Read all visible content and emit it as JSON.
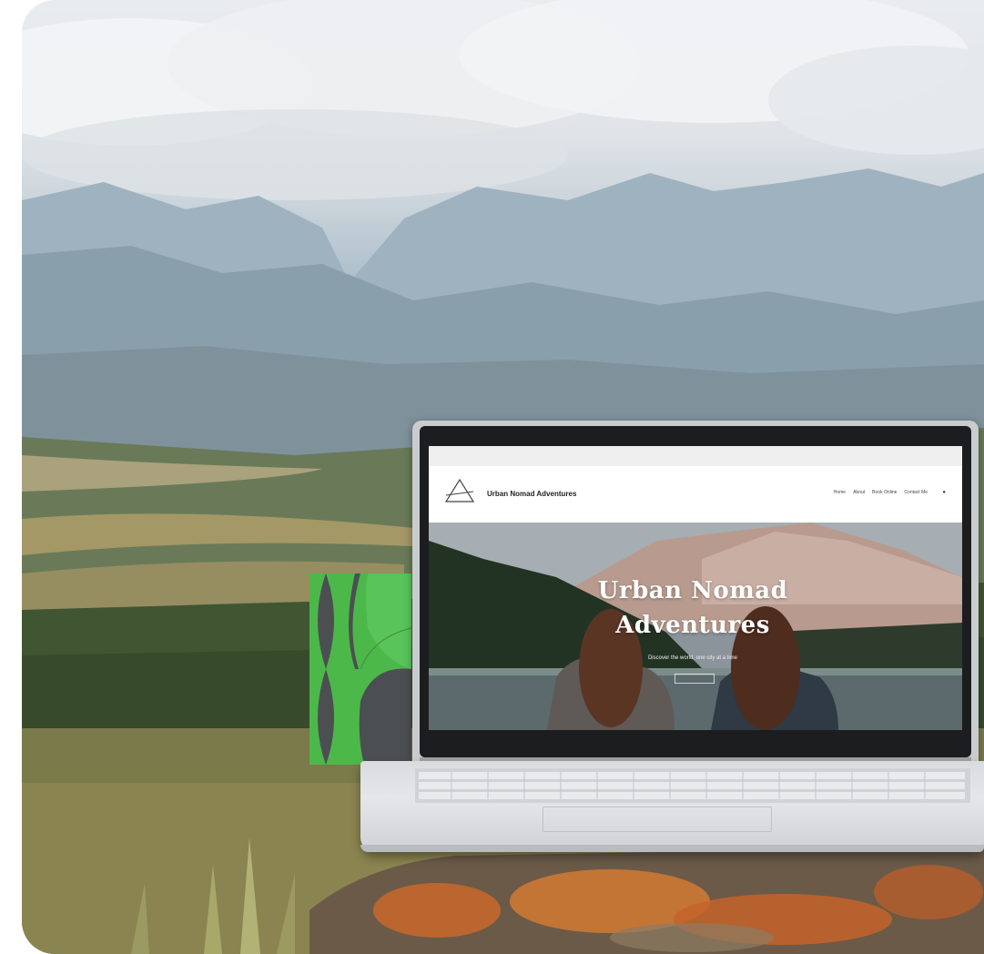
{
  "scene": {
    "description_colors": {
      "green_card": "#4cb84a",
      "sky": "#e9ecef",
      "rock_orange": "#c8692a"
    }
  },
  "website": {
    "site_title": "Urban Nomad Adventures",
    "nav": [
      "Home",
      "About",
      "Book Online",
      "Contact Me"
    ],
    "hero": {
      "title_line1": "Urban Nomad",
      "title_line2": "Adventures",
      "subtitle": "Discover the world, one city at a time"
    }
  },
  "icons": {
    "logo": "mountain-triangle-icon",
    "menu": "cart-icon"
  }
}
